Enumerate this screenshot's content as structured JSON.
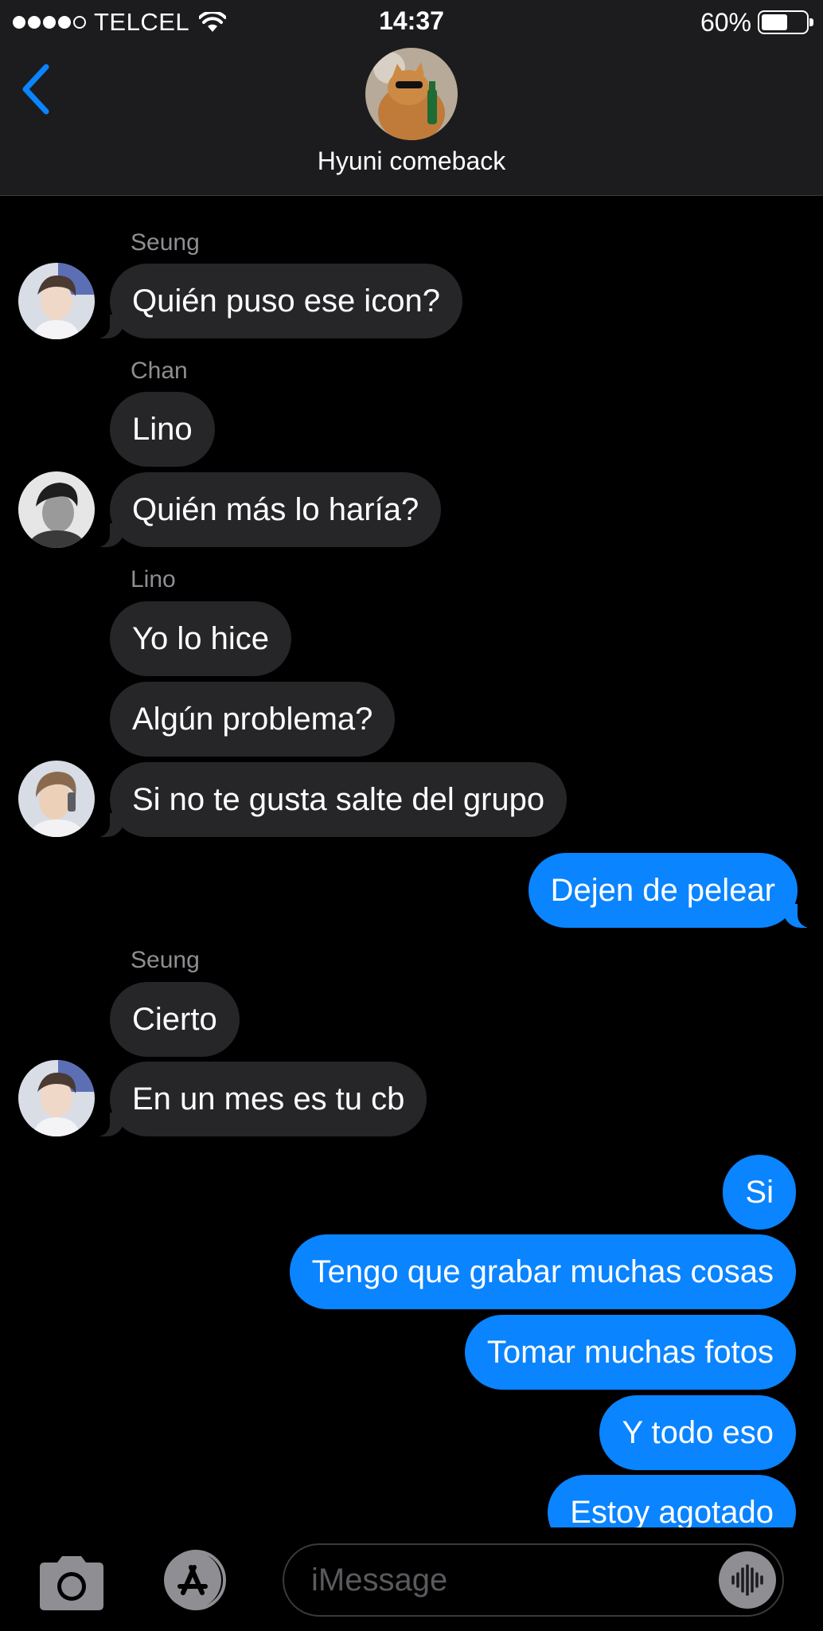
{
  "status": {
    "carrier": "TELCEL",
    "time": "14:37",
    "battery": "60%",
    "battery_level": 0.6,
    "signal_bars": 4
  },
  "header": {
    "group_name": "Hyuni comeback",
    "back_icon": "chevron-left-icon"
  },
  "messages": [
    {
      "sender": "Seung",
      "text": "Quién puso ese icon?",
      "side": "in"
    },
    {
      "sender": "Chan",
      "text": "Lino",
      "side": "in"
    },
    {
      "text": "Quién más lo haría?",
      "side": "in"
    },
    {
      "sender": "Lino",
      "text": "Yo lo hice",
      "side": "in"
    },
    {
      "text": "Algún problema?",
      "side": "in"
    },
    {
      "text": "Si no te gusta salte del grupo",
      "side": "in"
    },
    {
      "text": "Dejen de pelear",
      "side": "out"
    },
    {
      "sender": "Seung",
      "text": "Cierto",
      "side": "in"
    },
    {
      "text": "En un mes es tu cb",
      "side": "in"
    },
    {
      "text": "Si",
      "side": "out"
    },
    {
      "text": "Tengo que grabar muchas cosas",
      "side": "out"
    },
    {
      "text": "Tomar muchas fotos",
      "side": "out"
    },
    {
      "text": "Y todo eso",
      "side": "out"
    },
    {
      "text": "Estoy agotado",
      "side": "out"
    }
  ],
  "composer": {
    "placeholder": "iMessage",
    "camera_icon": "camera-icon",
    "apps_icon": "app-store-icon",
    "audio_icon": "audio-waveform-icon"
  },
  "colors": {
    "accent": "#0a84ff",
    "incoming_bubble": "#262629",
    "background": "#000000",
    "bar": "#1c1c1e"
  }
}
